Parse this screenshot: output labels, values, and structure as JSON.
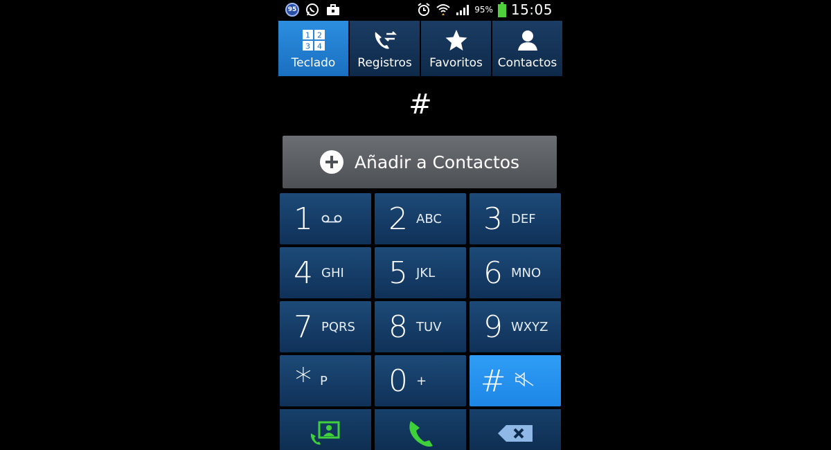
{
  "status_bar": {
    "notification_count": "95",
    "battery_percent": "95%",
    "time": "15:05"
  },
  "tabs": [
    {
      "label": "Teclado",
      "icon": "keypad-grid-icon",
      "active": true
    },
    {
      "label": "Registros",
      "icon": "call-log-icon",
      "active": false
    },
    {
      "label": "Favoritos",
      "icon": "star-icon",
      "active": false
    },
    {
      "label": "Contactos",
      "icon": "person-icon",
      "active": false
    }
  ],
  "keypad_grid_icon_digits": [
    "1",
    "2",
    "3",
    "4"
  ],
  "dialed_number": "#",
  "add_contact_label": "Añadir a Contactos",
  "keys": [
    {
      "digit": "1",
      "letters": ""
    },
    {
      "digit": "2",
      "letters": "ABC"
    },
    {
      "digit": "3",
      "letters": "DEF"
    },
    {
      "digit": "4",
      "letters": "GHI"
    },
    {
      "digit": "5",
      "letters": "JKL"
    },
    {
      "digit": "6",
      "letters": "MNO"
    },
    {
      "digit": "7",
      "letters": "PQRS"
    },
    {
      "digit": "8",
      "letters": "TUV"
    },
    {
      "digit": "9",
      "letters": "WXYZ"
    },
    {
      "digit": "*",
      "letters": "P"
    },
    {
      "digit": "0",
      "letters": "+"
    },
    {
      "digit": "#",
      "letters": ""
    }
  ],
  "colors": {
    "active_tab": "#2c8ee0",
    "key_bg": "#1d4a78",
    "active_key": "#2f9df5",
    "call_green": "#3fd13a",
    "backspace_blue": "#8fb8e6"
  }
}
